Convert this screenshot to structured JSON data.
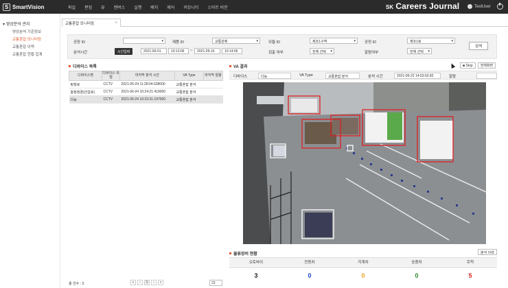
{
  "app": {
    "logo_letter": "S",
    "name": "SmartVision",
    "menu": [
      "파일",
      "편집",
      "뷰",
      "캔버스",
      "실행",
      "배치",
      "제어",
      "커뮤니티",
      "스마트 비전"
    ],
    "brand_prefix": "SK",
    "brand_name": "Careers Journal",
    "user": "TestUser"
  },
  "sidebar": {
    "group": "영상분석 관리",
    "items": [
      {
        "label": "영상분석 기준정보",
        "active": false
      },
      {
        "label": "교통혼잡 모니터링",
        "active": true
      },
      {
        "label": "교통혼잡 이력",
        "active": false
      },
      {
        "label": "교통혼잡 현황 집계",
        "active": false
      }
    ]
  },
  "tab": {
    "label": "교통혼잡 모니터링",
    "close": "×"
  },
  "filter": {
    "factory_label": "공장 ID",
    "factory_value": "",
    "product_label": "제품 ID",
    "product_value": "교통관제",
    "module_label": "모듈 ID",
    "module_value": "제조1구역",
    "process_label": "공정 ID",
    "process_value": "제조1로",
    "period_label": "분석시간",
    "time_btn": "시간입력",
    "start_date": "2021-06-01",
    "start_time": "10:13:06",
    "tilde": "~",
    "end_date": "2021-09-16",
    "end_time": "10:14:06",
    "detect_label": "검출 여부",
    "detect_value": "전체 선택",
    "alarm_label": "알람여부",
    "alarm_value": "전체 선택",
    "search_btn": "검색"
  },
  "devices": {
    "title": "디바이스 목록",
    "headers": [
      "디바이스명",
      "디바이스 유형",
      "마지막 분석 시간",
      "VA Type",
      "마지막 알람"
    ],
    "rows": [
      [
        "탕정로",
        "CCTV",
        "2021-06-24 11:28:04.628000",
        "교통혼잡 분석",
        ""
      ],
      [
        "충청정경(안길로)",
        "CCTV",
        "2021-06-24 10:24:21.419000",
        "교통혼잡 분석",
        ""
      ],
      [
        "다능",
        "CCTV",
        "2021-06-24 10:23:31.197000",
        "교통혼잡 분석",
        ""
      ]
    ],
    "selected": 2,
    "total_label": "총 건수 : 3",
    "pager": [
      "«",
      "‹",
      "1",
      "›",
      "»"
    ],
    "page_size": "23"
  },
  "va": {
    "title": "VA 결과",
    "stop_btn": "■ Stop",
    "fullscreen_btn": "전체화면",
    "device_label": "디바이스",
    "device_value": "다능",
    "type_label": "VA Type",
    "type_value": "교통혼잡 분석",
    "time_label": "분석 시간",
    "time_value": "2021-06-22 14:03:03.82",
    "alarm_label": "알람",
    "alarm_value": ""
  },
  "logistics": {
    "title": "물류장비 현황",
    "history_btn": "분석 이력",
    "columns": [
      {
        "label": "오토바이",
        "value": "3",
        "color": "#222222"
      },
      {
        "label": "전동차",
        "value": "0",
        "color": "#1a3fd1"
      },
      {
        "label": "지게차",
        "value": "0",
        "color": "#f0a020"
      },
      {
        "label": "승용차",
        "value": "0",
        "color": "#2a8a2a"
      },
      {
        "label": "트럭",
        "value": "5",
        "color": "#d92020"
      }
    ]
  },
  "colors": {
    "accent": "#e05a2b",
    "topbar": "#2b2b2b",
    "detect_red": "#e02020",
    "detect_white": "#ffffff"
  }
}
